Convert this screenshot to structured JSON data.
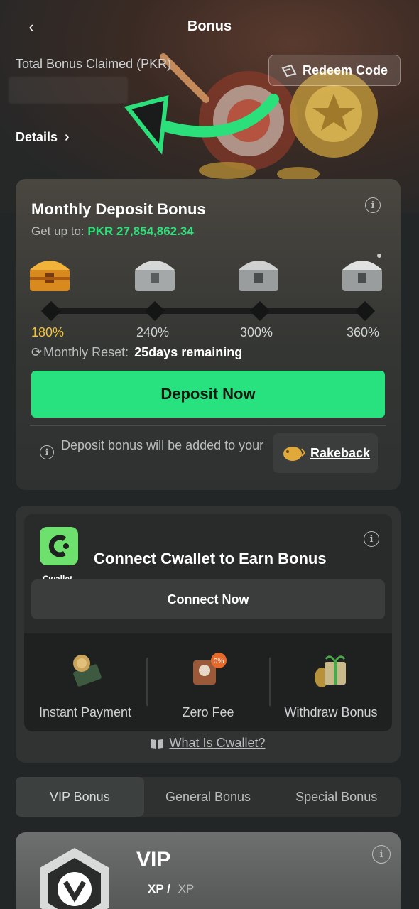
{
  "header": {
    "title": "Bonus",
    "total_bonus_label": "Total Bonus Claimed (PKR)",
    "redeem_label": "Redeem Code",
    "details_label": "Details"
  },
  "monthly_deposit": {
    "title": "Monthly Deposit Bonus",
    "get_up_to_label": "Get up to:",
    "get_up_to_amount": "PKR 27,854,862.34",
    "milestones": [
      "180%",
      "240%",
      "300%",
      "360%"
    ],
    "active_milestone": "180%",
    "reset_label": "Monthly Reset:",
    "reset_value": "25days remaining",
    "deposit_button": "Deposit Now",
    "note": "Deposit bonus will be added to your",
    "rakeback_label": "Rakeback"
  },
  "cwallet": {
    "logo_text": "Cwallet",
    "title": "Connect Cwallet to Earn Bonus",
    "connect_button": "Connect Now",
    "features": [
      "Instant Payment",
      "Zero Fee",
      "Withdraw Bonus"
    ],
    "what_is_link": "What Is Cwallet?"
  },
  "tabs": [
    {
      "label": "VIP Bonus",
      "active": true
    },
    {
      "label": "General Bonus",
      "active": false
    },
    {
      "label": "Special Bonus",
      "active": false
    }
  ],
  "vip": {
    "title": "VIP",
    "xp_current": "XP /",
    "xp_total": "XP"
  },
  "colors": {
    "accent_green": "#27e27e",
    "amount_green": "#2ee07a",
    "active_gold": "#f5c33b",
    "background": "#232626"
  }
}
